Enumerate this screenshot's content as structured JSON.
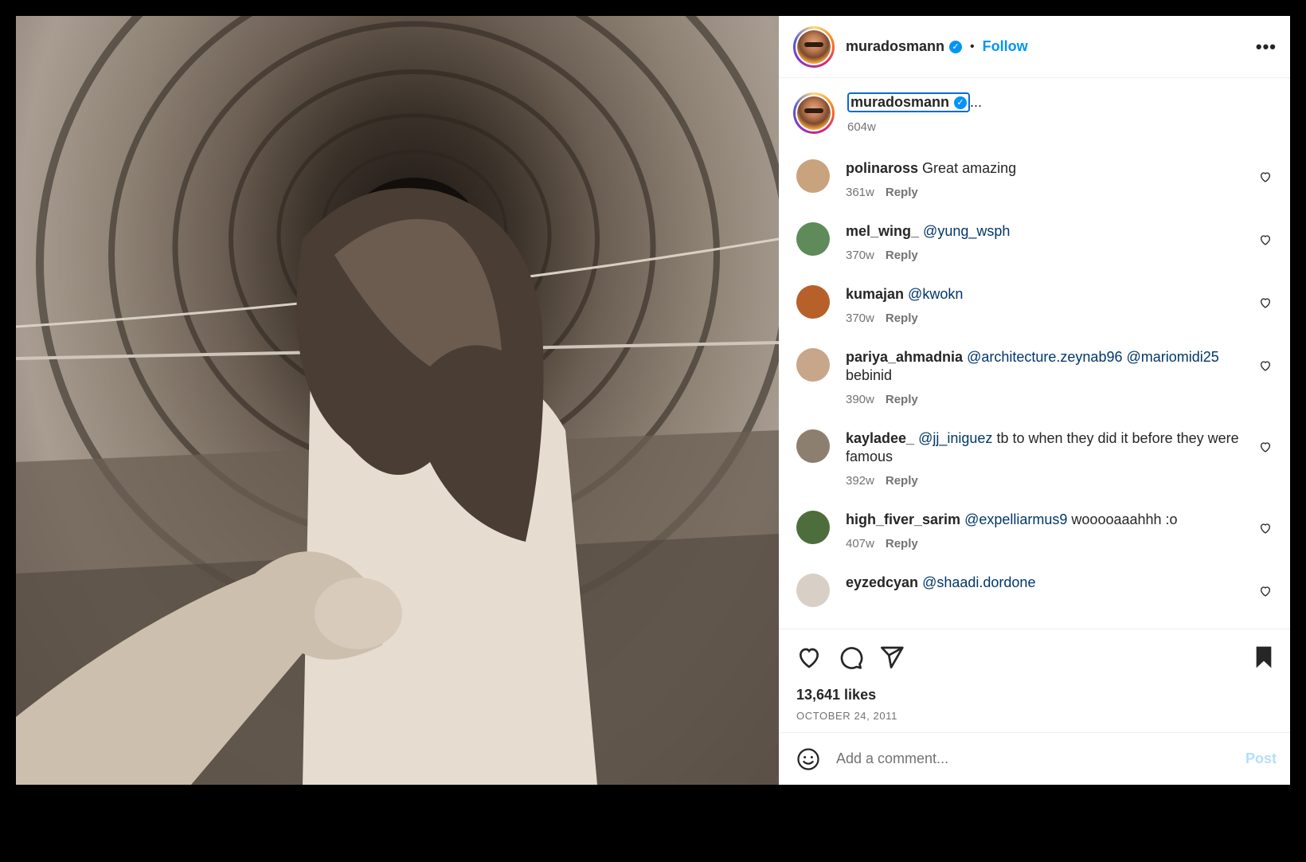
{
  "post": {
    "author": "muradosmann",
    "follow_label": "Follow",
    "dot": "•",
    "more_label": "•••",
    "caption_ellipsis": "...",
    "caption_age": "604w",
    "likes": "13,641 likes",
    "date": "OCTOBER 24, 2011",
    "add_comment_placeholder": "Add a comment...",
    "post_label": "Post",
    "reply_label": "Reply"
  },
  "comments": [
    {
      "user": "polinaross",
      "mention": "",
      "text": "Great amazing",
      "age": "361w",
      "avatar_color": "#c9a27e"
    },
    {
      "user": "mel_wing_",
      "mention": "@yung_wsph",
      "text": "",
      "age": "370w",
      "avatar_color": "#5f8a5a"
    },
    {
      "user": "kumajan",
      "mention": "@kwokn",
      "text": "",
      "age": "370w",
      "avatar_color": "#b8602a"
    },
    {
      "user": "pariya_ahmadnia",
      "mention": "@architecture.zeynab96 @mariomidi25",
      "text": "bebinid",
      "age": "390w",
      "avatar_color": "#c7a68a"
    },
    {
      "user": "kayladee_",
      "mention": "@jj_iniguez",
      "text": "tb to when they did it before they were famous",
      "age": "392w",
      "avatar_color": "#8d7f70"
    },
    {
      "user": "high_fiver_sarim",
      "mention": "@expelliarmus9",
      "text": "wooooaaahhh :o",
      "age": "407w",
      "avatar_color": "#4d6e3c"
    },
    {
      "user": "eyzedcyan",
      "mention": "@shaadi.dordone",
      "text": "",
      "age": "",
      "avatar_color": "#d8cfc6"
    }
  ],
  "icons": [
    "verified-badge-icon",
    "more-options-icon",
    "heart-icon",
    "comment-icon",
    "share-icon",
    "bookmark-icon",
    "emoji-icon"
  ],
  "colors": {
    "accent": "#0095f6",
    "mention": "#00376b",
    "muted": "#737373",
    "post_disabled": "#b2dffc"
  }
}
